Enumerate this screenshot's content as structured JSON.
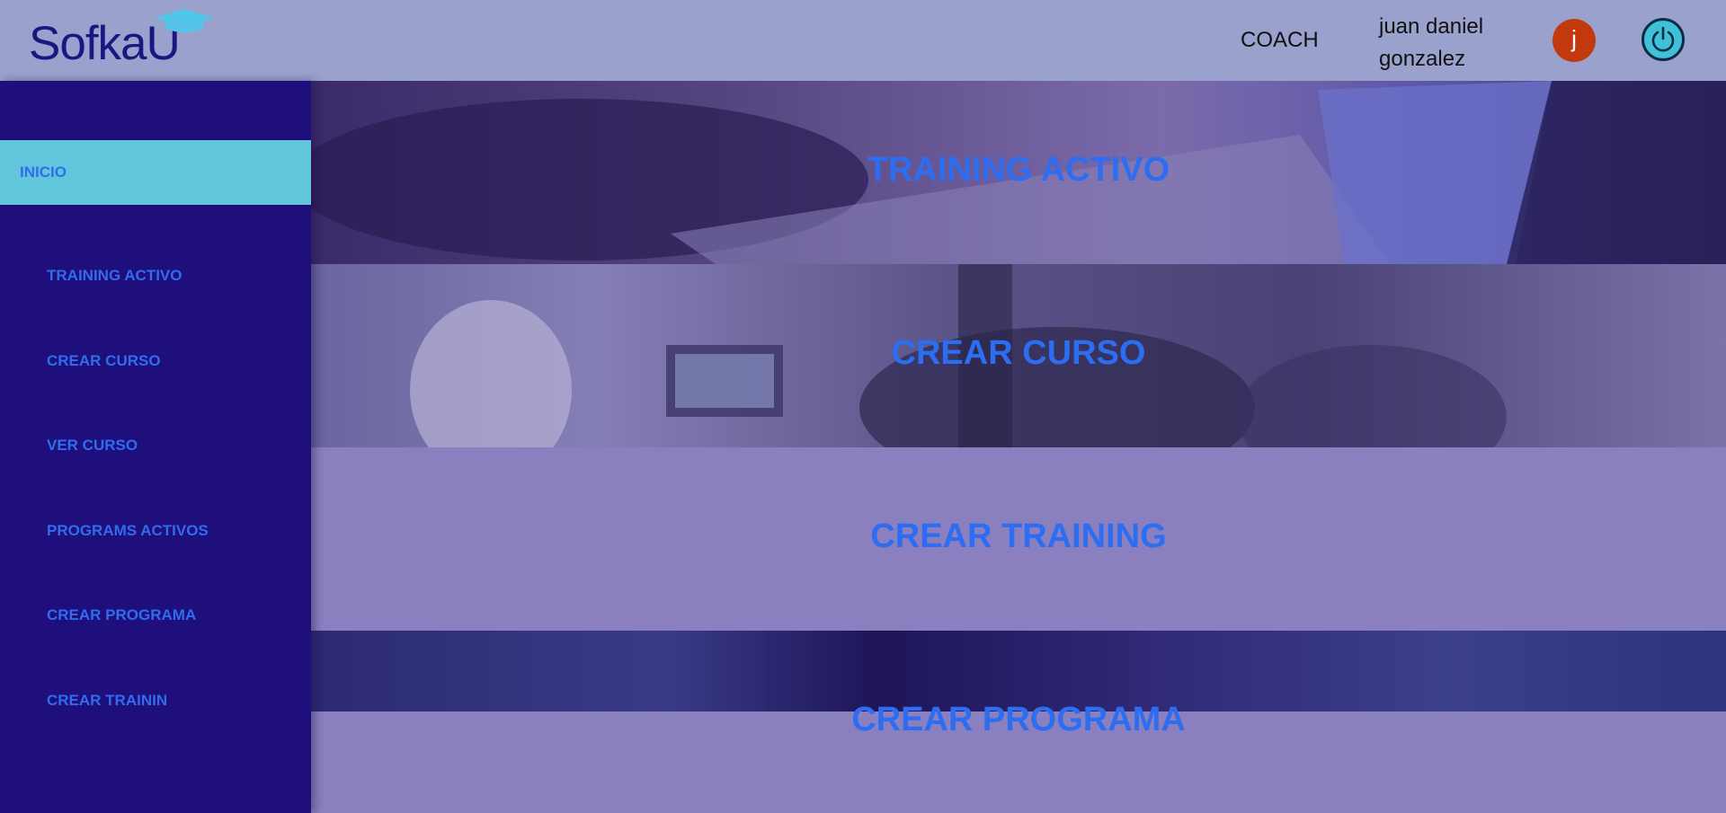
{
  "header": {
    "logo_text": "SofkaU",
    "role": "COACH",
    "user_name": "juan daniel gonzalez",
    "avatar_initial": "j"
  },
  "sidebar": {
    "home_label": "INICIO",
    "items": [
      {
        "label": "TRAINING ACTIVO"
      },
      {
        "label": "CREAR CURSO"
      },
      {
        "label": "VER CURSO"
      },
      {
        "label": "PROGRAMS ACTIVOS"
      },
      {
        "label": "CREAR PROGRAMA"
      },
      {
        "label": "CREAR TRAININ"
      }
    ]
  },
  "cards": [
    {
      "title": "TRAINING ACTIVO"
    },
    {
      "title": "CREAR CURSO"
    },
    {
      "title": "CREAR TRAINING"
    },
    {
      "title": "CREAR PROGRAMA"
    }
  ],
  "colors": {
    "header_bg": "#9aa1cc",
    "sidebar_bg": "#1f0f7d",
    "sidebar_active_bg": "#61c5dc",
    "link_blue": "#2f6dee",
    "avatar_bg": "#c2390e",
    "power_bg": "#3ec1d9"
  },
  "icons": {
    "logo_cap": "graduation-cap-icon",
    "power": "power-icon"
  }
}
